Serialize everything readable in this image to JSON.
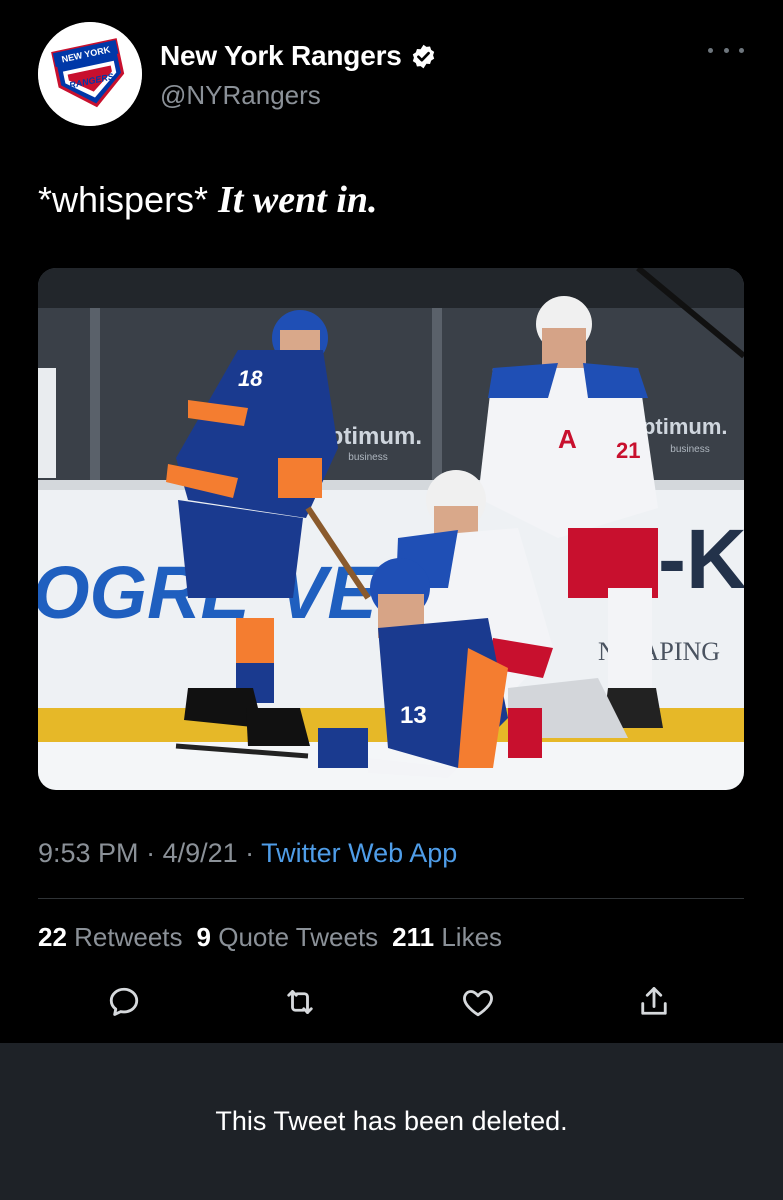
{
  "author": {
    "display_name": "New York Rangers",
    "handle": "@NYRangers",
    "avatar_text_top": "NEW YORK",
    "avatar_text_bottom": "RANGERS",
    "verified_icon": "verified-badge-icon"
  },
  "tweet": {
    "text_plain": "*whispers* ",
    "text_emphasis": "It went in.",
    "media": {
      "alt_subject": "hockey players on ice",
      "board_text_left": "OGRE",
      "board_text_mid": "VE",
      "board_text_right": "-K",
      "board_text_small": "ND APING",
      "glass_logo": "optimum.",
      "glass_logo_sub": "business",
      "jersey_numbers": [
        "18",
        "13",
        "21"
      ],
      "captain_letter": "A"
    }
  },
  "meta": {
    "time": "9:53 PM",
    "sep1": " · ",
    "date": "4/9/21",
    "sep2": " · ",
    "app": "Twitter Web App"
  },
  "stats": {
    "retweets_count": "22",
    "retweets_label": " Retweets",
    "quotes_count": "9",
    "quotes_label": " Quote Tweets",
    "likes_count": "211",
    "likes_label": " Likes"
  },
  "actions": {
    "reply_icon": "reply-icon",
    "retweet_icon": "retweet-icon",
    "like_icon": "heart-icon",
    "share_icon": "share-icon"
  },
  "notice": {
    "deleted_text": "This Tweet has been deleted."
  },
  "colors": {
    "background": "#000000",
    "secondary_text": "#8b9198",
    "link": "#4f9de8",
    "verified": "#ffffff",
    "notice_bg": "#1e2227"
  }
}
